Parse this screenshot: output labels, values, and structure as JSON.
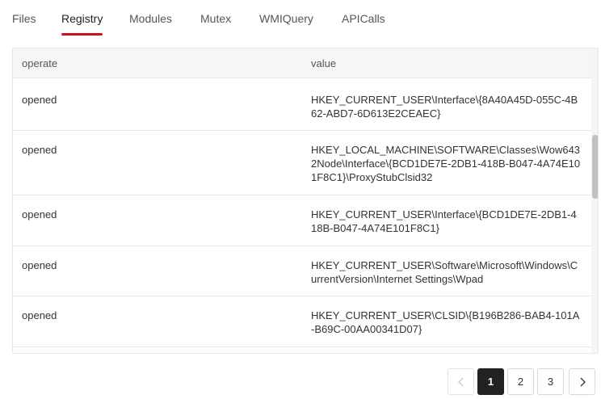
{
  "tabs": [
    {
      "label": "Files"
    },
    {
      "label": "Registry"
    },
    {
      "label": "Modules"
    },
    {
      "label": "Mutex"
    },
    {
      "label": "WMIQuery"
    },
    {
      "label": "APICalls"
    }
  ],
  "active_tab": "Registry",
  "accent_color": "#c8141e",
  "table": {
    "columns": [
      "operate",
      "value"
    ],
    "rows": [
      {
        "operate": "opened",
        "value": "HKEY_CURRENT_USER\\Interface\\{8A40A45D-055C-4B62-ABD7-6D613E2CEAEC}"
      },
      {
        "operate": "opened",
        "value": "HKEY_LOCAL_MACHINE\\SOFTWARE\\Classes\\Wow6432Node\\Interface\\{BCD1DE7E-2DB1-418B-B047-4A74E101F8C1}\\ProxyStubClsid32"
      },
      {
        "operate": "opened",
        "value": "HKEY_CURRENT_USER\\Interface\\{BCD1DE7E-2DB1-418B-B047-4A74E101F8C1}"
      },
      {
        "operate": "opened",
        "value": "HKEY_CURRENT_USER\\Software\\Microsoft\\Windows\\CurrentVersion\\Internet Settings\\Wpad"
      },
      {
        "operate": "opened",
        "value": "HKEY_CURRENT_USER\\CLSID\\{B196B286-BAB4-101A-B69C-00AA00341D07}"
      }
    ]
  },
  "pagination": {
    "pages": [
      "1",
      "2",
      "3"
    ],
    "current": "1",
    "prev_icon": "chevron-left-icon",
    "next_icon": "chevron-right-icon"
  }
}
